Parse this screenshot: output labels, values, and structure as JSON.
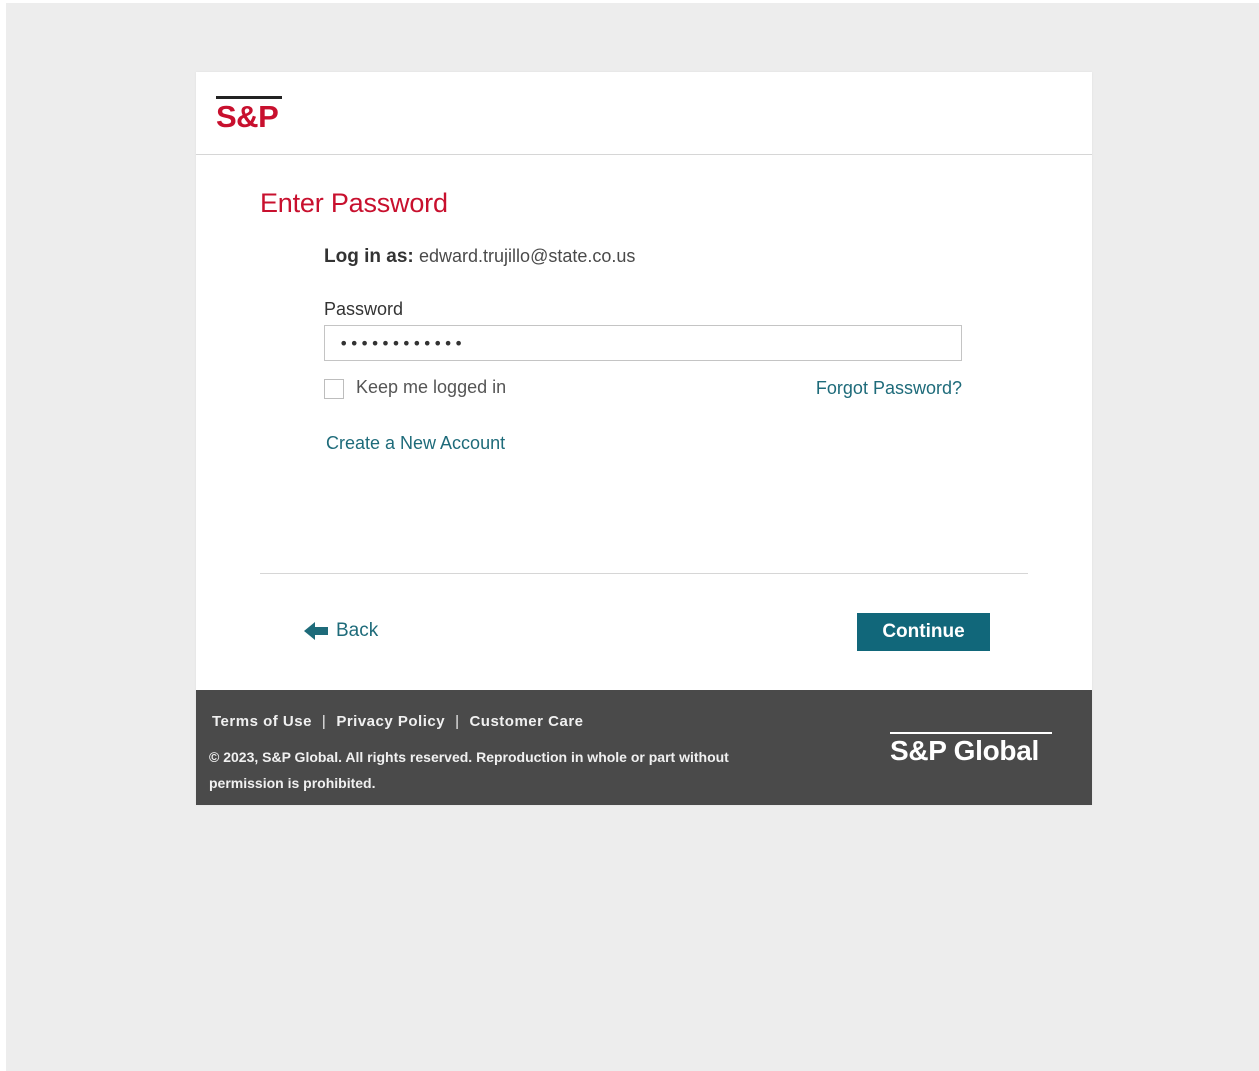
{
  "brand": {
    "logo_text": "S&P",
    "footer_logo_text": "S&P Global",
    "accent_color": "#c8102e",
    "link_color": "#1e6b7a",
    "button_color": "#11677a"
  },
  "form": {
    "title": "Enter Password",
    "login_as_label": "Log in as:",
    "login_as_email": "edward.trujillo@state.co.us",
    "password_label": "Password",
    "password_value": "••••••••••••",
    "keep_logged_in_label": "Keep me logged in",
    "keep_logged_in_checked": false,
    "forgot_password_label": "Forgot Password?",
    "create_account_label": "Create a New Account"
  },
  "actions": {
    "back_label": "Back",
    "continue_label": "Continue"
  },
  "footer": {
    "links": [
      "Terms of Use",
      "Privacy Policy",
      "Customer Care"
    ],
    "separator": "|",
    "copyright": "© 2023, S&P Global. All rights reserved. Reproduction in whole or part without permission is prohibited."
  }
}
